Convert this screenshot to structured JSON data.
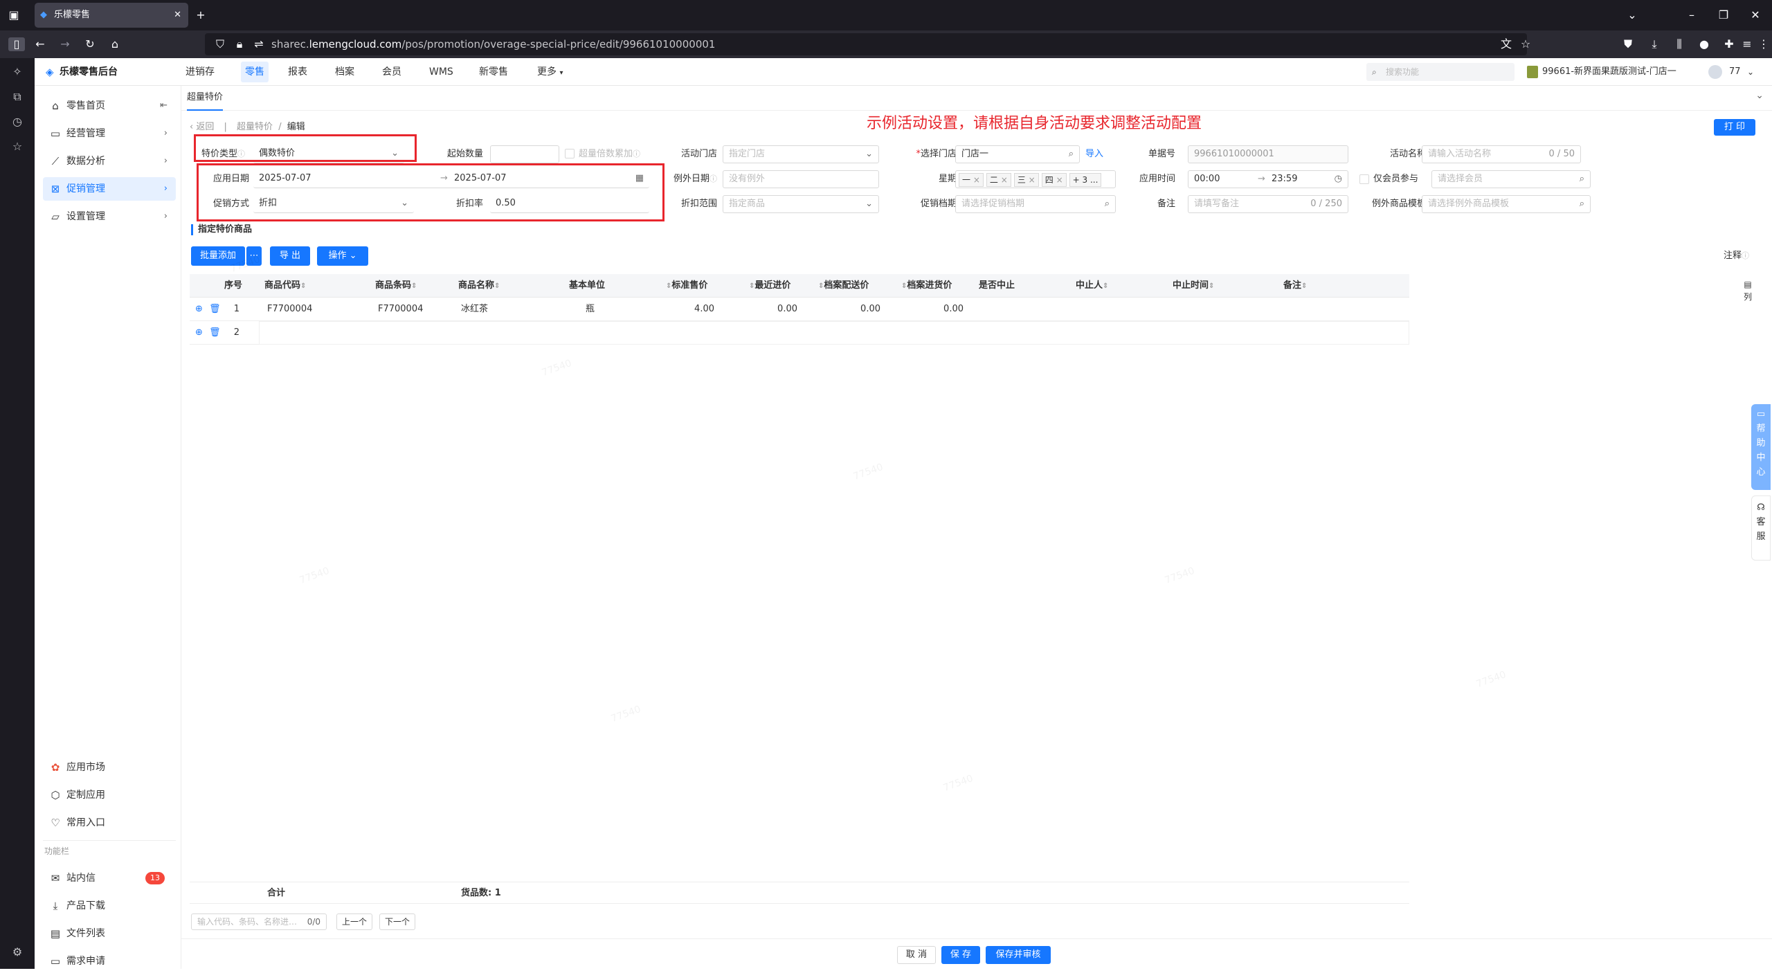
{
  "browser": {
    "tab_title": "乐檬零售",
    "url_prefix": "sharec.",
    "url_domain": "lemengcloud.com",
    "url_path": "/pos/promotion/overage-special-price/edit/99661010000001"
  },
  "app": {
    "logo_text": "乐檬零售后台",
    "nav": [
      "进销存",
      "零售",
      "报表",
      "档案",
      "会员",
      "WMS",
      "新零售",
      "更多"
    ],
    "search_placeholder": "搜索功能",
    "store_name": "99661-新界面果蔬版测试-门店一",
    "user_count": "77"
  },
  "sidebar": {
    "items": [
      {
        "label": "零售首页"
      },
      {
        "label": "经营管理"
      },
      {
        "label": "数据分析"
      },
      {
        "label": "促销管理"
      },
      {
        "label": "设置管理"
      }
    ],
    "bottom": [
      {
        "label": "应用市场"
      },
      {
        "label": "定制应用"
      },
      {
        "label": "常用入口"
      }
    ],
    "section_label": "功能栏",
    "func": [
      {
        "label": "站内信",
        "badge": "13"
      },
      {
        "label": "产品下载"
      },
      {
        "label": "文件列表"
      },
      {
        "label": "需求申请"
      }
    ]
  },
  "page": {
    "tab_label": "超量特价",
    "back_label": "返回",
    "crumb_parent": "超量特价",
    "crumb_current": "编辑",
    "annotation": "示例活动设置，请根据自身活动要求调整活动配置",
    "print_label": "打 印"
  },
  "form": {
    "price_type_label": "特价类型",
    "price_type_value": "偶数特价",
    "start_qty_label": "起始数量",
    "overage_label": "超量倍数累加",
    "store_label": "活动门店",
    "store_placeholder": "指定门店",
    "select_store_label": "选择门店",
    "select_store_value": "门店一",
    "import_label": "导入",
    "doc_no_label": "单据号",
    "doc_no_value": "99661010000001",
    "act_name_label": "活动名称",
    "act_name_placeholder": "请输入活动名称",
    "act_name_count": "0 / 50",
    "date_label": "应用日期",
    "date_start": "2025-07-07",
    "date_end": "2025-07-07",
    "except_date_label": "例外日期",
    "except_date_placeholder": "没有例外",
    "week_label": "星期",
    "week_tags": [
      "一",
      "二",
      "三",
      "四"
    ],
    "week_more": "+ 3 ...",
    "time_label": "应用时间",
    "time_start": "00:00",
    "time_end": "23:59",
    "member_only_label": "仅会员参与",
    "member_placeholder": "请选择会员",
    "promo_method_label": "促销方式",
    "promo_method_value": "折扣",
    "discount_rate_label": "折扣率",
    "discount_rate_value": "0.50",
    "discount_range_label": "折扣范围",
    "discount_range_placeholder": "指定商品",
    "promo_file_label": "促销档期",
    "promo_file_placeholder": "请选择促销档期",
    "remark_label": "备注",
    "remark_placeholder": "请填写备注",
    "remark_count": "0 / 250",
    "except_tpl_label": "例外商品模板",
    "except_tpl_placeholder": "请选择例外商品模板"
  },
  "goods": {
    "section_title": "指定特价商品",
    "batch_add": "批量添加",
    "export": "导 出",
    "operate": "操作",
    "note_label": "注释",
    "columns_label": "列",
    "headers": [
      "序号",
      "商品代码",
      "商品条码",
      "商品名称",
      "基本单位",
      "标准售价",
      "最近进价",
      "档案配送价",
      "档案进货价",
      "是否中止",
      "中止人",
      "中止时间",
      "备注"
    ],
    "rows": [
      {
        "no": "1",
        "code": "F7700004",
        "barcode": "F7700004",
        "name": "冰红茶",
        "unit": "瓶",
        "price": "4.00",
        "last_cost": "0.00",
        "dist_price": "0.00",
        "purchase_price": "0.00"
      },
      {
        "no": "2"
      }
    ],
    "total_label": "合计",
    "goods_count": "货品数: 1",
    "search_placeholder": "输入代码、条码、名称进…",
    "search_count": "0/0",
    "prev": "上一个",
    "next": "下一个"
  },
  "float_help": "帮助中心",
  "float_service": "客服",
  "footer": {
    "cancel": "取 消",
    "save": "保 存",
    "save_audit": "保存并审核"
  },
  "watermark": "77540"
}
